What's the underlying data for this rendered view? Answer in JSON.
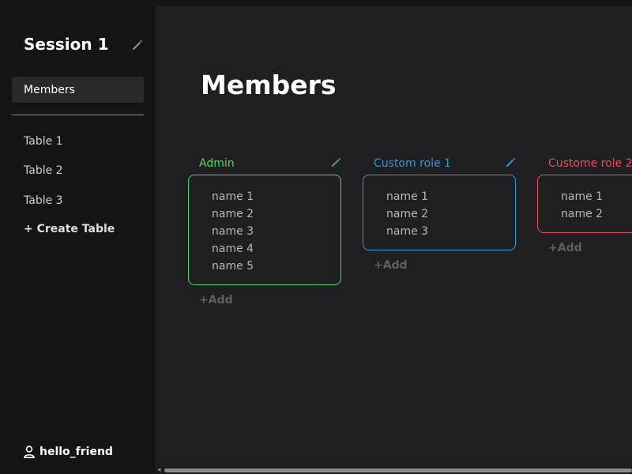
{
  "sidebar": {
    "session_title": "Session 1",
    "nav_members": "Members",
    "tables": [
      "Table 1",
      "Table 2",
      "Table 3"
    ],
    "create_table": "+ Create Table",
    "username": "hello_friend"
  },
  "main": {
    "title": "Members",
    "roles": [
      {
        "name": "Admin",
        "color": "#4cd964",
        "members": [
          "name 1",
          "name 2",
          "name 3",
          "name 4",
          "name 5"
        ],
        "add_label": "+Add",
        "editable": true
      },
      {
        "name": "Custom role 1",
        "color": "#2f9bd6",
        "members": [
          "name 1",
          "name 2",
          "name 3"
        ],
        "add_label": "+Add",
        "editable": true
      },
      {
        "name": "Custome role 2",
        "color": "#e8505b",
        "members": [
          "name 1",
          "name 2"
        ],
        "add_label": "+Add",
        "editable": false
      }
    ]
  },
  "icons": {
    "session_edit": "pencil-icon",
    "user": "user-icon",
    "scroll_left": "chevron-left-icon"
  },
  "colors": {
    "sidebar_bg": "#141315",
    "main_bg": "#1f1e20",
    "selected_nav_bg": "#29282b"
  }
}
